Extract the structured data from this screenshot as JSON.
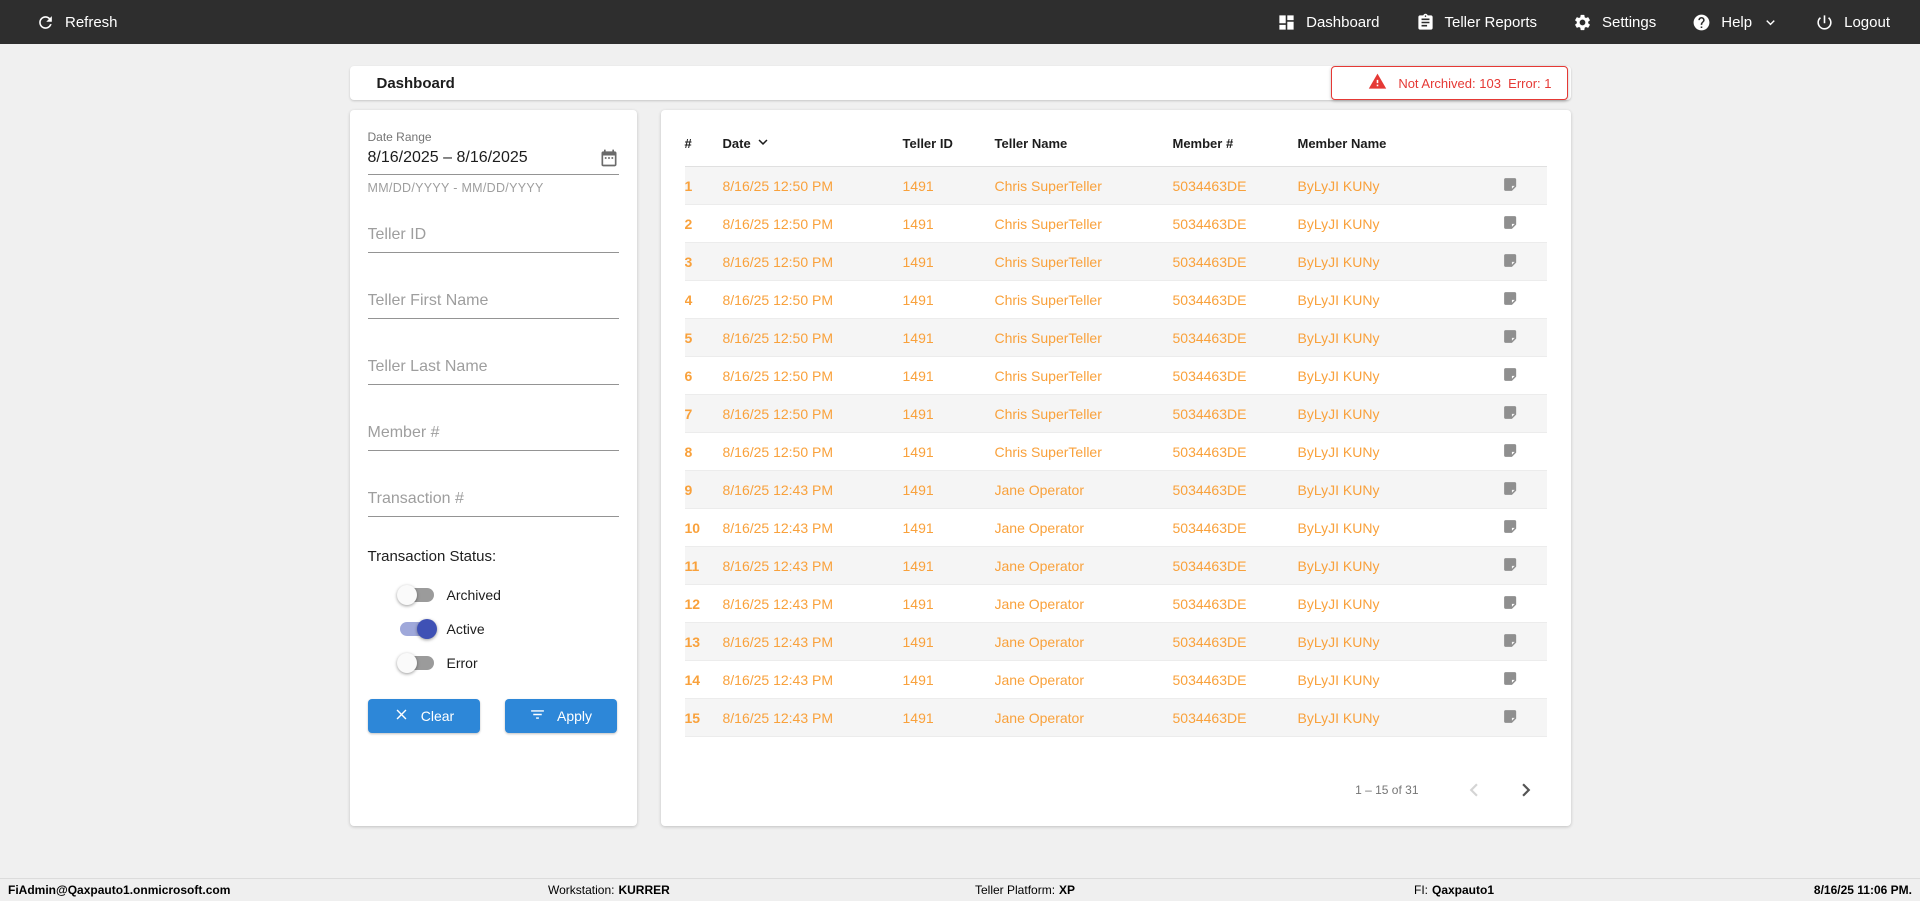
{
  "colors": {
    "topbar_bg": "#2E2E2E",
    "accent_orange": "#F9A13B",
    "alert_red": "#E53935",
    "button_blue": "#2D87D8",
    "toggle_on": "#3F51B5",
    "toggle_on_track": "#9FA8DA"
  },
  "topbar": {
    "refresh_label": "Refresh",
    "nav": [
      {
        "label": "Dashboard"
      },
      {
        "label": "Teller Reports"
      },
      {
        "label": "Settings"
      },
      {
        "label": "Help"
      },
      {
        "label": "Logout"
      }
    ]
  },
  "header": {
    "title": "Dashboard",
    "alert_text": "Not Archived: 103  Error: 1"
  },
  "filters": {
    "date_range": {
      "label": "Date Range",
      "value": "8/16/2025 – 8/16/2025",
      "hint": "MM/DD/YYYY - MM/DD/YYYY"
    },
    "inputs": [
      {
        "placeholder": "Teller ID"
      },
      {
        "placeholder": "Teller First Name"
      },
      {
        "placeholder": "Teller Last Name"
      },
      {
        "placeholder": "Member #"
      },
      {
        "placeholder": "Transaction #"
      }
    ],
    "status_label": "Transaction Status:",
    "toggles": [
      {
        "label": "Archived",
        "on": false
      },
      {
        "label": "Active",
        "on": true
      },
      {
        "label": "Error",
        "on": false
      }
    ],
    "clear_label": "Clear",
    "apply_label": "Apply"
  },
  "table": {
    "columns": [
      "#",
      "Date",
      "Teller ID",
      "Teller Name",
      "Member #",
      "Member Name"
    ],
    "sorted_by": "Date",
    "rows": [
      {
        "num": "1",
        "date": "8/16/25 12:50 PM",
        "teller_id": "1491",
        "teller_name": "Chris SuperTeller",
        "member_number": "5034463DE",
        "member_name": "ByLyJI KUNy"
      },
      {
        "num": "2",
        "date": "8/16/25 12:50 PM",
        "teller_id": "1491",
        "teller_name": "Chris SuperTeller",
        "member_number": "5034463DE",
        "member_name": "ByLyJI KUNy"
      },
      {
        "num": "3",
        "date": "8/16/25 12:50 PM",
        "teller_id": "1491",
        "teller_name": "Chris SuperTeller",
        "member_number": "5034463DE",
        "member_name": "ByLyJI KUNy"
      },
      {
        "num": "4",
        "date": "8/16/25 12:50 PM",
        "teller_id": "1491",
        "teller_name": "Chris SuperTeller",
        "member_number": "5034463DE",
        "member_name": "ByLyJI KUNy"
      },
      {
        "num": "5",
        "date": "8/16/25 12:50 PM",
        "teller_id": "1491",
        "teller_name": "Chris SuperTeller",
        "member_number": "5034463DE",
        "member_name": "ByLyJI KUNy"
      },
      {
        "num": "6",
        "date": "8/16/25 12:50 PM",
        "teller_id": "1491",
        "teller_name": "Chris SuperTeller",
        "member_number": "5034463DE",
        "member_name": "ByLyJI KUNy"
      },
      {
        "num": "7",
        "date": "8/16/25 12:50 PM",
        "teller_id": "1491",
        "teller_name": "Chris SuperTeller",
        "member_number": "5034463DE",
        "member_name": "ByLyJI KUNy"
      },
      {
        "num": "8",
        "date": "8/16/25 12:50 PM",
        "teller_id": "1491",
        "teller_name": "Chris SuperTeller",
        "member_number": "5034463DE",
        "member_name": "ByLyJI KUNy"
      },
      {
        "num": "9",
        "date": "8/16/25 12:43 PM",
        "teller_id": "1491",
        "teller_name": "Jane Operator",
        "member_number": "5034463DE",
        "member_name": "ByLyJI KUNy"
      },
      {
        "num": "10",
        "date": "8/16/25 12:43 PM",
        "teller_id": "1491",
        "teller_name": "Jane Operator",
        "member_number": "5034463DE",
        "member_name": "ByLyJI KUNy"
      },
      {
        "num": "11",
        "date": "8/16/25 12:43 PM",
        "teller_id": "1491",
        "teller_name": "Jane Operator",
        "member_number": "5034463DE",
        "member_name": "ByLyJI KUNy"
      },
      {
        "num": "12",
        "date": "8/16/25 12:43 PM",
        "teller_id": "1491",
        "teller_name": "Jane Operator",
        "member_number": "5034463DE",
        "member_name": "ByLyJI KUNy"
      },
      {
        "num": "13",
        "date": "8/16/25 12:43 PM",
        "teller_id": "1491",
        "teller_name": "Jane Operator",
        "member_number": "5034463DE",
        "member_name": "ByLyJI KUNy"
      },
      {
        "num": "14",
        "date": "8/16/25 12:43 PM",
        "teller_id": "1491",
        "teller_name": "Jane Operator",
        "member_number": "5034463DE",
        "member_name": "ByLyJI KUNy"
      },
      {
        "num": "15",
        "date": "8/16/25 12:43 PM",
        "teller_id": "1491",
        "teller_name": "Jane Operator",
        "member_number": "5034463DE",
        "member_name": "ByLyJI KUNy"
      }
    ],
    "pagination": {
      "range_label": "1 – 15 of 31"
    }
  },
  "statusbar": {
    "user": "FiAdmin@Qaxpauto1.onmicrosoft.com",
    "workstation_label": "Workstation:",
    "workstation_value": "KURRER",
    "platform_label": "Teller Platform:",
    "platform_value": "XP",
    "fi_label": "FI:",
    "fi_value": "Qaxpauto1",
    "datetime": "8/16/25 11:06 PM."
  }
}
